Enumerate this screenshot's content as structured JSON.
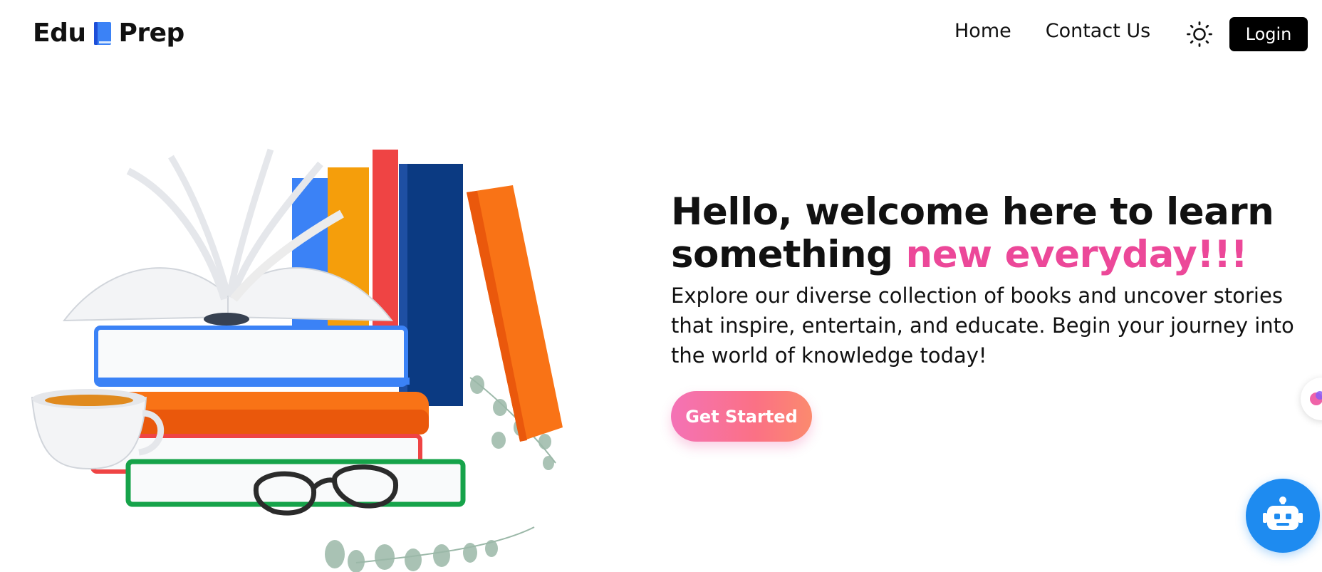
{
  "brand": {
    "left": "Edu",
    "right": "Prep",
    "icon": "blue-book-icon"
  },
  "nav": {
    "home": "Home",
    "contact": "Contact Us",
    "theme_icon": "sun-icon",
    "login": "Login"
  },
  "hero": {
    "title_main": "Hello, welcome here to learn something",
    "title_accent": "new everyday!!!",
    "description": "Explore our diverse collection of books and uncover stories that inspire, entertain, and educate. Begin your journey into the world of knowledge today!",
    "cta": "Get Started",
    "illustration": "stack-of-books-illustration"
  },
  "widgets": {
    "side_icon": "brain-icon",
    "chat_icon": "robot-icon"
  },
  "colors": {
    "accent": "#ec4899",
    "login_bg": "#000000",
    "bot_bg": "#1e8bf0"
  }
}
